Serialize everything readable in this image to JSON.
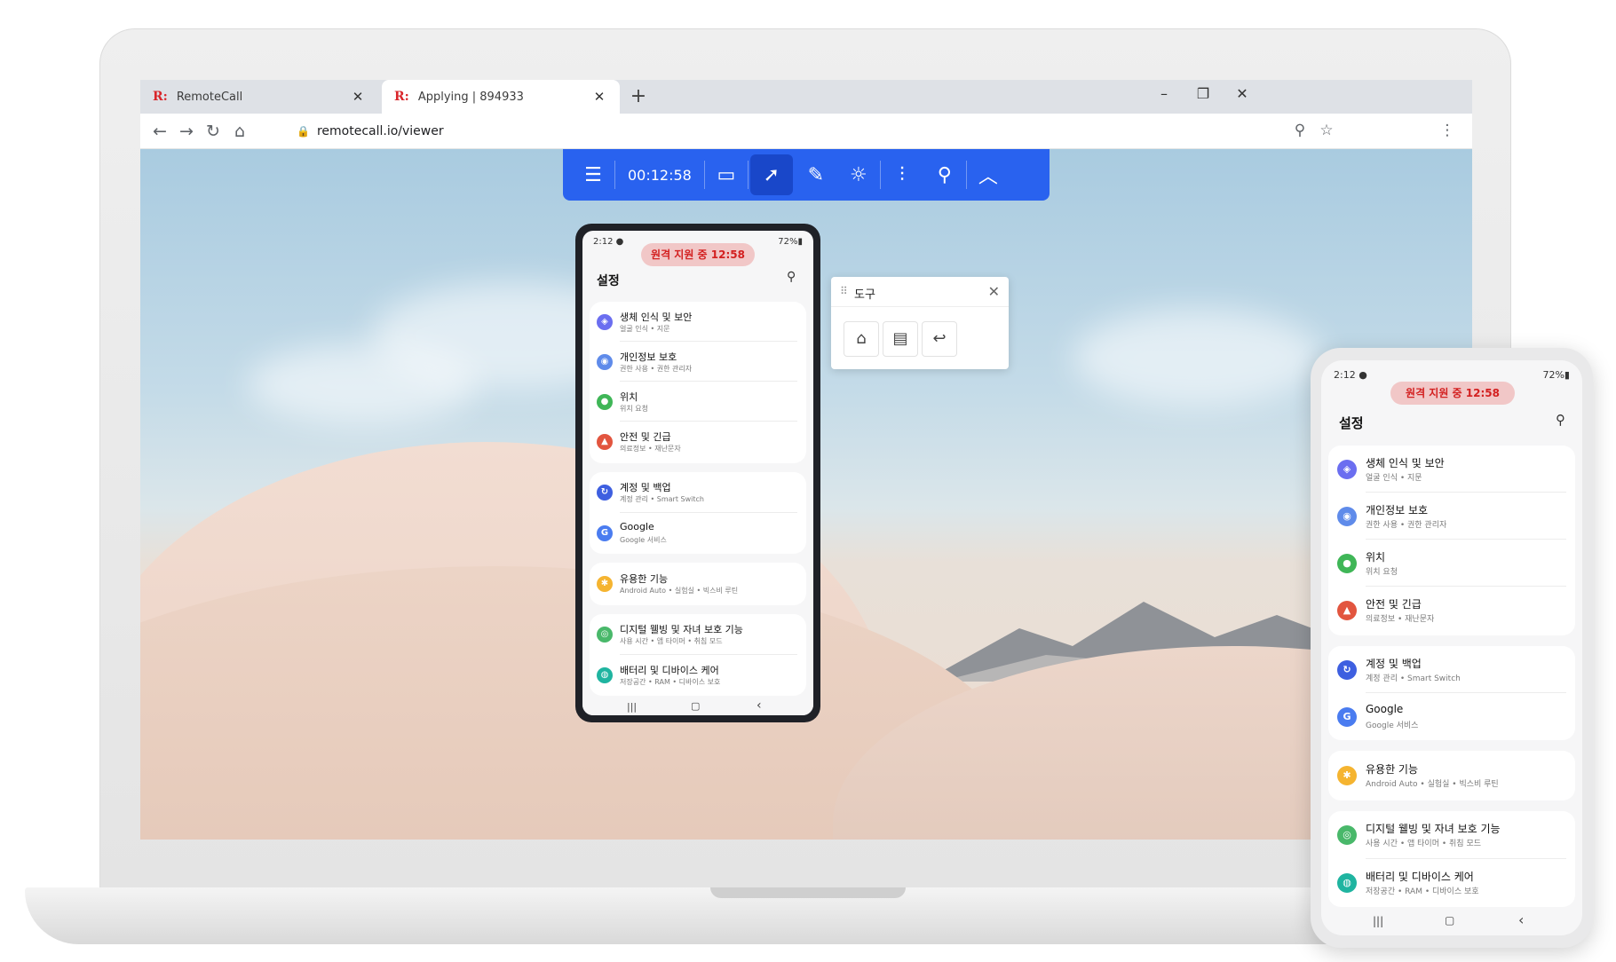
{
  "browser": {
    "tabs": [
      {
        "favicon": "R:",
        "title": "RemoteCall",
        "close": "✕"
      },
      {
        "favicon": "R:",
        "title": "Applying | 894933",
        "close": "✕"
      }
    ],
    "new_tab": "+",
    "window_controls": {
      "minimize": "–",
      "restore": "❐",
      "close": "✕"
    },
    "nav": {
      "back": "←",
      "forward": "→",
      "reload": "↻",
      "home": "⌂"
    },
    "url": "remotecall.io/viewer",
    "lock": "🔒",
    "zoom": "⚲",
    "star": "☆",
    "menu": "⋮"
  },
  "toolbar": {
    "menu_icon": "☰",
    "timer": "00:12:58",
    "camera_icon": "▭",
    "pointer_icon": "➚",
    "pen_icon": "✎",
    "brightness_icon": "☼",
    "settings_icon": "⫶",
    "zoom_icon": "⚲",
    "collapse_icon": "︿"
  },
  "tools_popup": {
    "grip": "⠿",
    "title": "도구",
    "close": "✕",
    "home": "⌂",
    "recents": "▤",
    "back": "↩"
  },
  "phone": {
    "time": "2:12 ●",
    "battery": "72%▮",
    "session_pill": "원격 지원 중   12:58",
    "title": "설정",
    "search_icon": "⚲",
    "groups": [
      {
        "items": [
          {
            "title": "생체 인식 및 보안",
            "subtitle": "얼굴 인식 • 지문",
            "icon": "◈",
            "color": "#6b6ef0"
          },
          {
            "title": "개인정보 보호",
            "subtitle": "권한 사용 • 권한 관리자",
            "icon": "◉",
            "color": "#5f8bea"
          },
          {
            "title": "위치",
            "subtitle": "위치 요청",
            "icon": "●",
            "color": "#3fb657"
          },
          {
            "title": "안전 및 긴급",
            "subtitle": "의료정보 • 재난문자",
            "icon": "▲",
            "color": "#e2553f"
          }
        ]
      },
      {
        "items": [
          {
            "title": "계정 및 백업",
            "subtitle": "계정 관리 • Smart Switch",
            "icon": "↻",
            "color": "#3e5fe0"
          },
          {
            "title": "Google",
            "subtitle": "Google 서비스",
            "icon": "G",
            "color": "#4a7cf0"
          }
        ]
      },
      {
        "items": [
          {
            "title": "유용한 기능",
            "subtitle": "Android Auto • 실험실 • 빅스비 루틴",
            "icon": "✱",
            "color": "#f5b430"
          }
        ]
      },
      {
        "items": [
          {
            "title": "디지털 웰빙 및 자녀 보호 기능",
            "subtitle": "사용 시간 • 앱 타이머 • 취침 모드",
            "icon": "◎",
            "color": "#49b86a"
          },
          {
            "title": "배터리 및 디바이스 케어",
            "subtitle": "저장공간 • RAM • 디바이스 보호",
            "icon": "◍",
            "color": "#1fb4a0"
          }
        ]
      }
    ],
    "nav": {
      "recents": "|||",
      "home": "▢",
      "back": "‹"
    }
  }
}
